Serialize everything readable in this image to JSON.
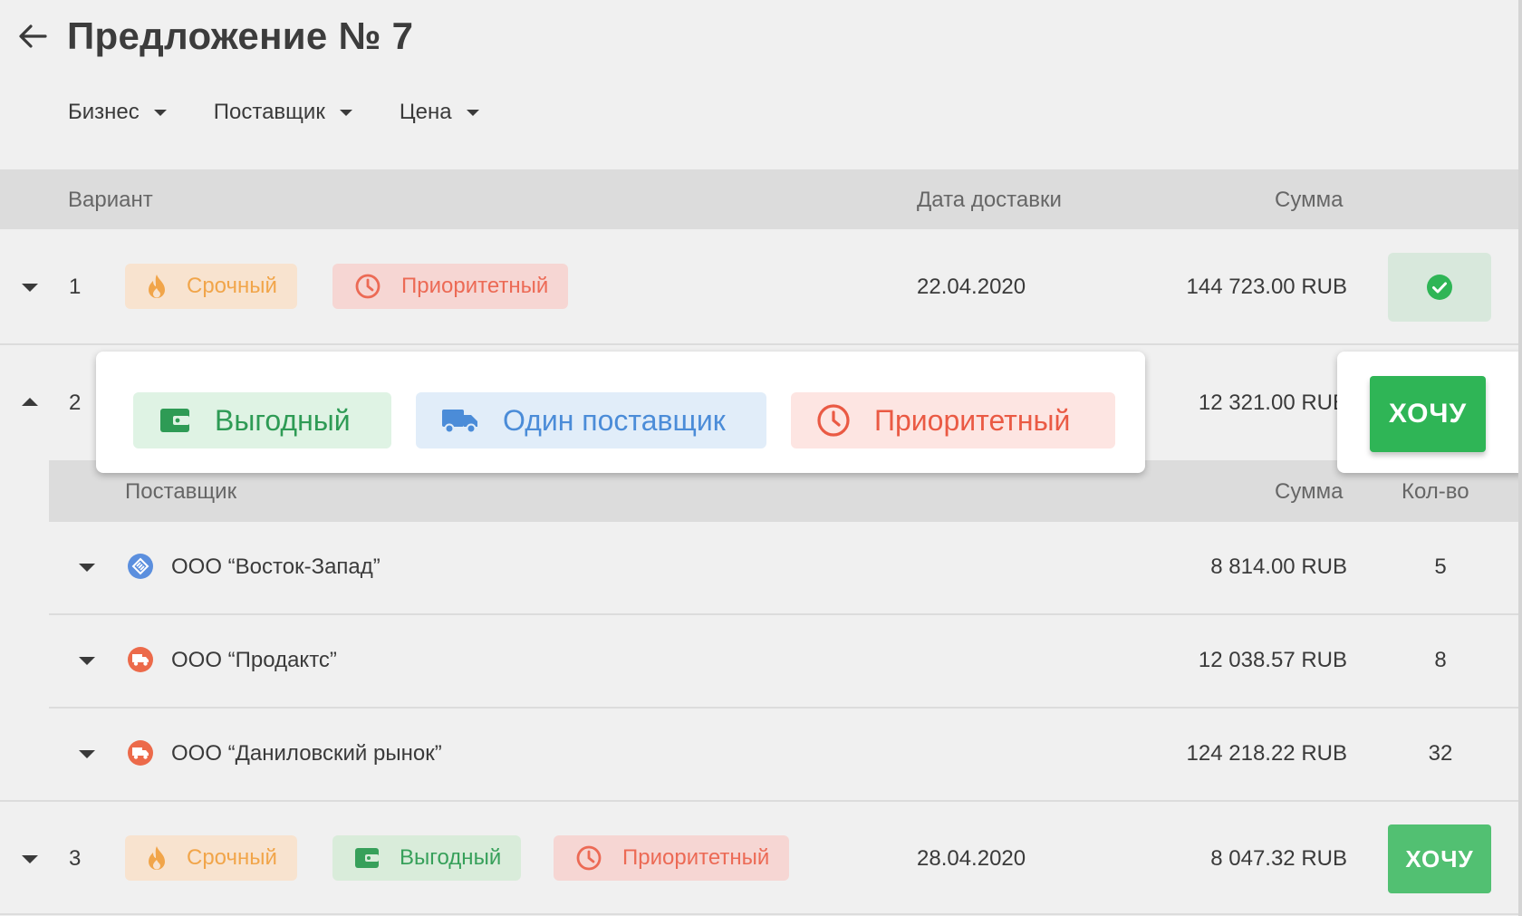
{
  "header": {
    "title": "Предложение № 7"
  },
  "filters": [
    {
      "label": "Бизнес"
    },
    {
      "label": "Поставщик"
    },
    {
      "label": "Цена"
    }
  ],
  "table": {
    "columns": {
      "variant": "Вариант",
      "delivery_date": "Дата доставки",
      "sum": "Сумма"
    }
  },
  "tags": {
    "urgent": "Срочный",
    "priority": "Приоритетный",
    "profit": "Выгодный",
    "one_supplier": "Один поставщик"
  },
  "rows": [
    {
      "number": "1",
      "date": "22.04.2020",
      "sum": "144 723.00 RUB"
    },
    {
      "number": "2",
      "sum": "12 321.00 RUB"
    },
    {
      "number": "3",
      "date": "28.04.2020",
      "sum": "8 047.32 RUB"
    }
  ],
  "want_label": "ХОЧУ",
  "sub_table": {
    "columns": {
      "supplier": "Поставщик",
      "sum": "Сумма",
      "qty": "Кол-во"
    },
    "rows": [
      {
        "name": "ООО “Восток-Запад”",
        "sum": "8 814.00 RUB",
        "qty": "5",
        "icon": "supplier-pattern-icon"
      },
      {
        "name": "ООО “Продактс”",
        "sum": "12 038.57 RUB",
        "qty": "8",
        "icon": "truck-icon"
      },
      {
        "name": "ООО “Даниловский рынок”",
        "sum": "124 218.22 RUB",
        "qty": "32",
        "icon": "truck-icon"
      }
    ]
  },
  "colors": {
    "accent_green": "#2fb556",
    "urgent": "#f1a54a",
    "priority": "#ec6a55",
    "profit": "#37a05a",
    "supplier_blue": "#4b8cd8"
  }
}
